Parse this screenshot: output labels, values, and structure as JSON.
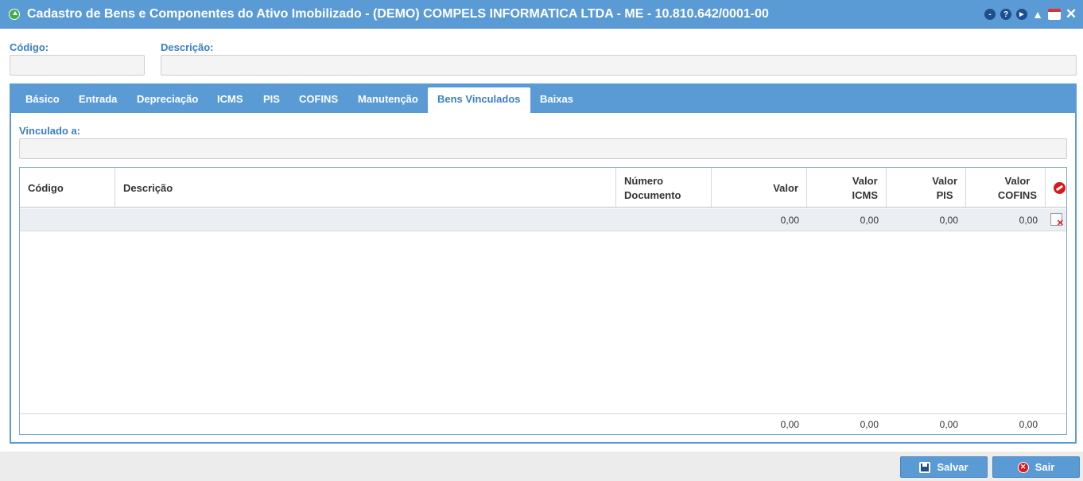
{
  "window": {
    "title": "Cadastro de Bens e Componentes do Ativo Imobilizado - (DEMO) COMPELS INFORMATICA LTDA - ME - 10.810.642/0001-00",
    "tools": {
      "minimize": "-",
      "help": "?",
      "next": "►",
      "bell": "▲",
      "calendar": "",
      "close": "✕"
    }
  },
  "form": {
    "codigo_label": "Código:",
    "codigo_value": "",
    "descricao_label": "Descrição:",
    "descricao_value": ""
  },
  "tabs": [
    {
      "label": "Básico"
    },
    {
      "label": "Entrada"
    },
    {
      "label": "Depreciação"
    },
    {
      "label": "ICMS"
    },
    {
      "label": "PIS"
    },
    {
      "label": "COFINS"
    },
    {
      "label": "Manutenção"
    },
    {
      "label": "Bens Vinculados"
    },
    {
      "label": "Baixas"
    }
  ],
  "active_tab": "Bens Vinculados",
  "vinculado": {
    "label": "Vinculado a:",
    "value": ""
  },
  "grid": {
    "headers": {
      "codigo": "Código",
      "descricao": "Descrição",
      "numero": "Número",
      "documento": "Documento",
      "valor": "Valor",
      "valor_icms_1": "Valor",
      "valor_icms_2": "ICMS",
      "valor_pis_1": "Valor",
      "valor_pis_2": "PIS",
      "valor_cofins_1": "Valor",
      "valor_cofins_2": "COFINS"
    },
    "rows": [
      {
        "codigo": "",
        "descricao": "",
        "numero_documento": "",
        "valor": "0,00",
        "valor_icms": "0,00",
        "valor_pis": "0,00",
        "valor_cofins": "0,00"
      }
    ],
    "totals": {
      "valor": "0,00",
      "valor_icms": "0,00",
      "valor_pis": "0,00",
      "valor_cofins": "0,00"
    }
  },
  "buttons": {
    "salvar": "Salvar",
    "sair": "Sair"
  },
  "colors": {
    "primary": "#5b9bd5",
    "label": "#3a7fc4",
    "danger": "#d7191c",
    "row_bg": "#ebeff4"
  }
}
